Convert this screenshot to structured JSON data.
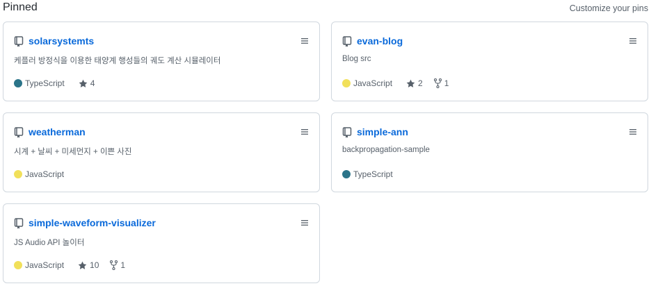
{
  "header": {
    "title": "Pinned",
    "customize_label": "Customize your pins"
  },
  "cards": [
    {
      "name": "solarsystemts",
      "description": "케플러 방정식을 이용한 태양계 행성들의 궤도 계산 시뮬레이터",
      "language": "TypeScript",
      "language_color": "#2b7489",
      "stars": "4",
      "forks": null
    },
    {
      "name": "evan-blog",
      "description": "Blog src",
      "language": "JavaScript",
      "language_color": "#f1e05a",
      "stars": "2",
      "forks": "1"
    },
    {
      "name": "weatherman",
      "description": "시계 + 날씨 + 미세먼지 + 이쁜 사진",
      "language": "JavaScript",
      "language_color": "#f1e05a",
      "stars": null,
      "forks": null
    },
    {
      "name": "simple-ann",
      "description": "backpropagation-sample",
      "language": "TypeScript",
      "language_color": "#2b7489",
      "stars": null,
      "forks": null
    },
    {
      "name": "simple-waveform-visualizer",
      "description": "JS Audio API 놀이터",
      "language": "JavaScript",
      "language_color": "#f1e05a",
      "stars": "10",
      "forks": "1"
    }
  ],
  "icons": {
    "repo": "repo-icon",
    "drag": "grabber-icon",
    "star": "star-icon",
    "fork": "fork-icon"
  }
}
